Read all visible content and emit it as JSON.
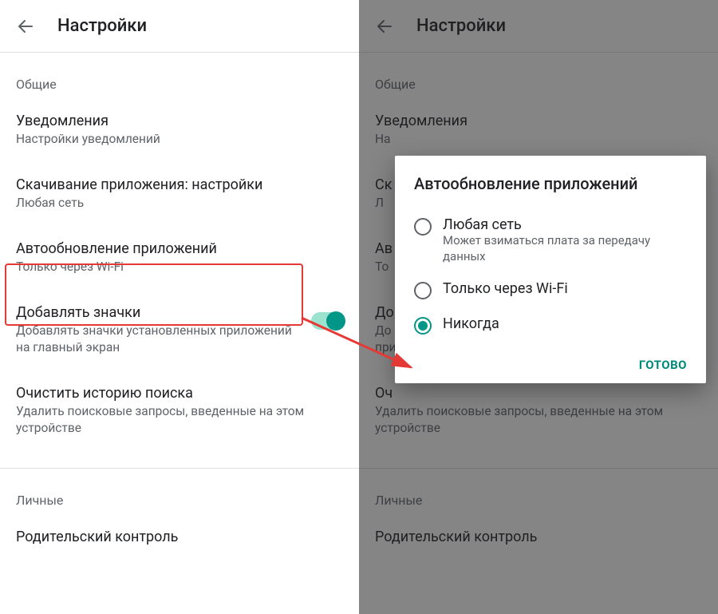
{
  "left": {
    "title": "Настройки",
    "section_general": "Общие",
    "items": {
      "notifications": {
        "title": "Уведомления",
        "sub": "Настройки уведомлений"
      },
      "download": {
        "title": "Скачивание приложения: настройки",
        "sub": "Любая сеть"
      },
      "autoupdate": {
        "title": "Автообновление приложений",
        "sub": "Только через Wi-Fi"
      },
      "icons": {
        "title": "Добавлять значки",
        "sub": "Добавлять значки установленных приложений на главный экран"
      },
      "clear_history": {
        "title": "Очистить историю поиска",
        "sub": "Удалить поисковые запросы, введенные на этом устройстве"
      }
    },
    "section_personal": "Личные",
    "parental": {
      "title": "Родительский контроль"
    }
  },
  "right": {
    "title": "Настройки",
    "section_general": "Общие",
    "items": {
      "notifications": {
        "title": "Уведомления",
        "sub": "На"
      },
      "download": {
        "title": "Ск",
        "sub": "Л"
      },
      "autoupdate": {
        "title": "Ав",
        "sub": "То"
      },
      "icons": {
        "title": "До",
        "sub": "До\nпри"
      },
      "clear_history": {
        "title": "Оч",
        "sub": "Удалить поисковые запросы, введенные на этом устройстве"
      }
    },
    "section_personal": "Личные",
    "parental": {
      "title": "Родительский контроль"
    },
    "dialog": {
      "title": "Автообновление приложений",
      "options": {
        "any": {
          "label": "Любая сеть",
          "sub": "Может взиматься плата за передачу данных"
        },
        "wifi": {
          "label": "Только через Wi-Fi"
        },
        "never": {
          "label": "Никогда"
        }
      },
      "confirm": "Готово"
    }
  }
}
